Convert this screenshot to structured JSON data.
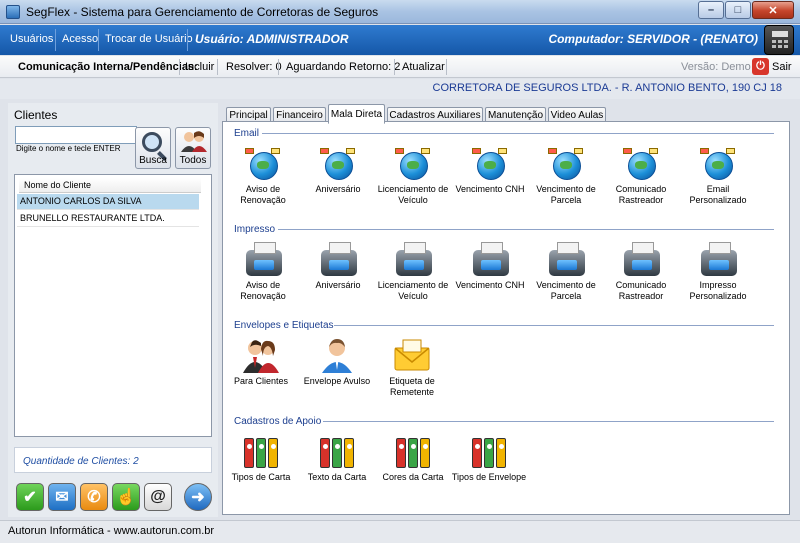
{
  "window": {
    "title": "SegFlex - Sistema para Gerenciamento de Corretoras de Seguros"
  },
  "menu": {
    "items": [
      "Usuários",
      "Acesso",
      "Trocar de Usuário"
    ],
    "user": "Usuário: ADMINISTRADOR",
    "computer": "Computador: SERVIDOR - (RENATO)"
  },
  "toolbar": {
    "comm_label": "Comunicação Interna/Pendências:",
    "include": "Incluir",
    "resolve": "Resolver: 0",
    "awaiting": "Aguardando Retorno: 2",
    "refresh": "Atualizar",
    "version": "Versão: Demo",
    "exit": "Sair"
  },
  "company": "CORRETORA DE SEGUROS LTDA. - R. ANTONIO BENTO, 190 CJ 18",
  "clients": {
    "title": "Clientes",
    "search_value": "",
    "hint": "Digite o nome e tecle ENTER",
    "search_btn": "Busca",
    "all_btn": "Todos",
    "column": "Nome do Cliente",
    "rows": [
      "ANTONIO CARLOS DA SILVA",
      "BRUNELLO RESTAURANTE LTDA."
    ],
    "count": "Quantidade de Clientes: 2"
  },
  "tabs": [
    "Principal",
    "Financeiro",
    "Mala Direta",
    "Cadastros Auxiliares",
    "Manutenção",
    "Video Aulas"
  ],
  "sections": {
    "email": {
      "title": "Email",
      "items": [
        "Aviso de Renovação",
        "Aniversário",
        "Licenciamento de Veículo",
        "Vencimento CNH",
        "Vencimento de Parcela",
        "Comunicado Rastreador",
        "Email Personalizado"
      ]
    },
    "impresso": {
      "title": "Impresso",
      "items": [
        "Aviso de Renovação",
        "Aniversário",
        "Licenciamento de Veículo",
        "Vencimento CNH",
        "Vencimento de Parcela",
        "Comunicado Rastreador",
        "Impresso Personalizado"
      ]
    },
    "envelopes": {
      "title": "Envelopes e Etiquetas",
      "items": [
        "Para Clientes",
        "Envelope Avulso",
        "Etiqueta de Remetente"
      ]
    },
    "cadastros": {
      "title": "Cadastros de Apoio",
      "items": [
        "Tipos de Carta",
        "Texto da Carta",
        "Cores da Carta",
        "Tipos de Envelope"
      ]
    }
  },
  "statusbar": "Autorun Informática - www.autorun.com.br"
}
